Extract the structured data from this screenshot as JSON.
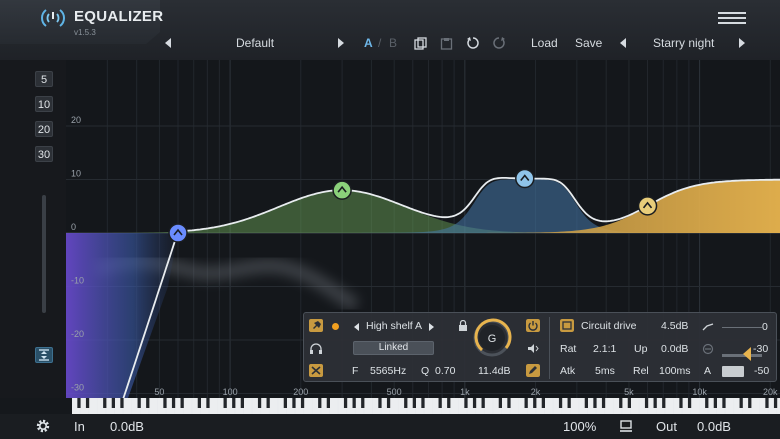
{
  "app": {
    "title": "EQUALIZER",
    "version": "v1.5.3",
    "logo_icon": "power-waves-icon",
    "menu_icon": "hamburger-icon"
  },
  "toolbar": {
    "preset": "Default",
    "ab_a": "A",
    "ab_sep": "/",
    "ab_b": "B",
    "copy_icon": "copy-icon",
    "paste_icon": "paste-icon",
    "undo_icon": "undo-icon",
    "redo_icon": "redo-icon",
    "load_label": "Load",
    "save_label": "Save",
    "program": "Starry night"
  },
  "sidebar": {
    "ranges": [
      "5",
      "10",
      "20",
      "30"
    ],
    "fit_icon": "fit-range-icon"
  },
  "graph": {
    "db_labels": [
      {
        "text": "20",
        "db": 20
      },
      {
        "text": "10",
        "db": 10
      },
      {
        "text": "0",
        "db": 0
      },
      {
        "text": "-10",
        "db": -10
      },
      {
        "text": "-20",
        "db": -20
      },
      {
        "text": "-30",
        "db": -30
      }
    ],
    "freq_labels": [
      {
        "text": "50",
        "hz": 50
      },
      {
        "text": "100",
        "hz": 100
      },
      {
        "text": "200",
        "hz": 200
      },
      {
        "text": "500",
        "hz": 500
      },
      {
        "text": "1k",
        "hz": 1000
      },
      {
        "text": "2k",
        "hz": 2000
      },
      {
        "text": "5k",
        "hz": 5000
      },
      {
        "text": "10k",
        "hz": 10000
      },
      {
        "text": "20k",
        "hz": 20000
      }
    ],
    "bands": [
      {
        "name": "low-cut",
        "color": "#6a8cff",
        "hz": 60,
        "db": 0
      },
      {
        "name": "peak-1",
        "color": "#8bd17a",
        "hz": 300,
        "db": 8
      },
      {
        "name": "peak-2",
        "color": "#8fc4ea",
        "hz": 1800,
        "db": 10
      },
      {
        "name": "high-shelf",
        "color": "#e8cd7a",
        "hz": 6000,
        "db": 10
      }
    ]
  },
  "band_panel": {
    "pin_icon": "pin-icon",
    "headphones_icon": "headphones-icon",
    "close_icon": "close-x-icon",
    "band_type": "High shelf A",
    "lock_icon": "lock-icon",
    "linked_label": "Linked",
    "f_label": "F",
    "f_value": "5565Hz",
    "q_label": "Q",
    "q_value": "0.70",
    "gain_label": "G",
    "gain_value": "11.4dB",
    "power_icon": "power-icon",
    "speaker_icon": "speaker-icon",
    "edit_icon": "edit-icon",
    "drive_icon": "drive-icon",
    "drive_label": "Circuit drive",
    "drive_value": "4.5dB",
    "rat_label": "Rat",
    "rat_value": "2.1:1",
    "up_label": "Up",
    "up_value": "0.0dB",
    "atk_label": "Atk",
    "atk_value": "5ms",
    "rel_label": "Rel",
    "rel_value": "100ms",
    "a_label": "A",
    "knee_value": "0",
    "thr_value": "-30",
    "range_value": "-50"
  },
  "bottom": {
    "settings_icon": "gear-icon",
    "in_label": "In",
    "in_value": "0.0dB",
    "zoom": "100%",
    "monitor_icon": "monitor-icon",
    "out_label": "Out",
    "out_value": "0.0dB"
  }
}
